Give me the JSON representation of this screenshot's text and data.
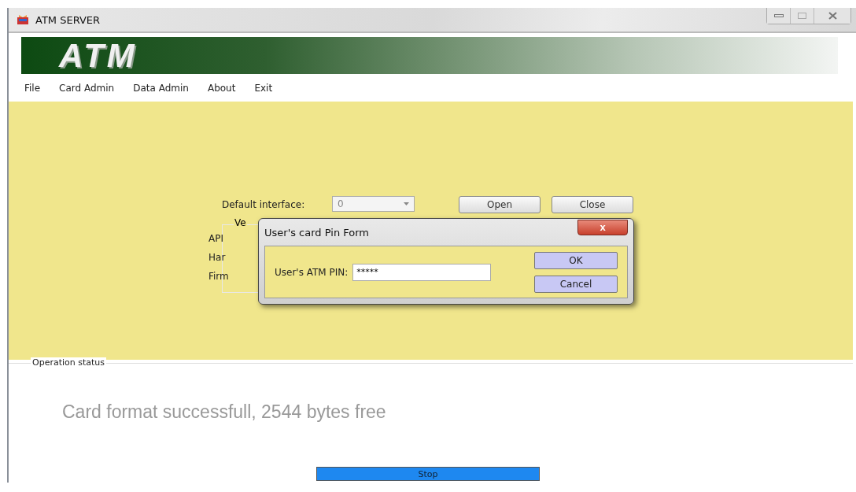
{
  "window": {
    "title": "ATM SERVER"
  },
  "banner": {
    "logo": "ATM"
  },
  "menu": [
    {
      "label": "File"
    },
    {
      "label": "Card Admin"
    },
    {
      "label": "Data Admin"
    },
    {
      "label": "About"
    },
    {
      "label": "Exit"
    }
  ],
  "settings": {
    "interface_label": "Default interface:",
    "interface_value": "0",
    "buttons": [
      "Open",
      "Close"
    ],
    "group_legend": "Ve",
    "group_labels": [
      "API",
      "Har",
      "Firm"
    ]
  },
  "dialog": {
    "title": "User's card Pin Form",
    "close": "x",
    "pin_label": "User's ATM PIN:",
    "pin_value": "*****",
    "buttons": [
      "OK",
      "Cancel"
    ]
  },
  "status": {
    "legend": "Operation status",
    "message": "Card format successfull, 2544 bytes free",
    "stop_button": "Stop"
  }
}
